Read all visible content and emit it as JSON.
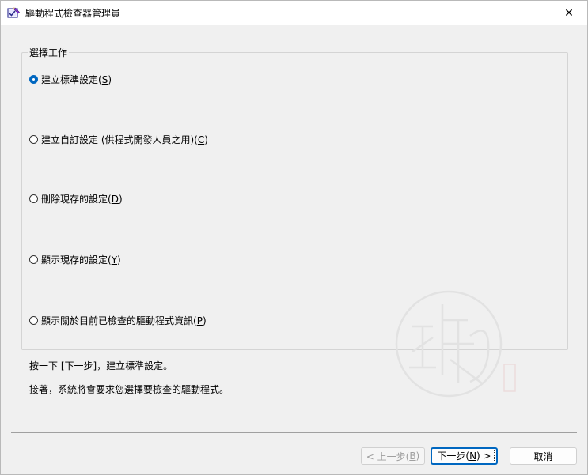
{
  "window": {
    "title": "驅動程式檢查器管理員",
    "close_symbol": "✕"
  },
  "group": {
    "label": "選擇工作",
    "options": [
      {
        "label": "建立標準設定(",
        "key": "S",
        "suffix": ")",
        "checked": true
      },
      {
        "label": "建立自訂設定 (供程式開發人員之用)(",
        "key": "C",
        "suffix": ")",
        "checked": false
      },
      {
        "label": "刪除現存的設定(",
        "key": "D",
        "suffix": ")",
        "checked": false
      },
      {
        "label": "顯示現存的設定(",
        "key": "Y",
        "suffix": ")",
        "checked": false
      },
      {
        "label": "顯示關於目前已檢查的驅動程式資訊(",
        "key": "P",
        "suffix": ")",
        "checked": false
      }
    ]
  },
  "info": {
    "line1": "按一下 [下一步]，建立標準設定。",
    "line2": "接著，系統將會要求您選擇要檢查的驅動程式。"
  },
  "buttons": {
    "back": {
      "prefix": "< 上一步(",
      "key": "B",
      "suffix": ")"
    },
    "next": {
      "prefix": "下一步(",
      "key": "N",
      "suffix": ") >"
    },
    "cancel": "取消"
  },
  "colors": {
    "accent": "#0067c0",
    "window_bg": "#f0f0f0",
    "title_bg": "#ffffff"
  },
  "icons": {
    "app": "checklist-pen-icon",
    "watermark": "seal-stamp-icon"
  }
}
